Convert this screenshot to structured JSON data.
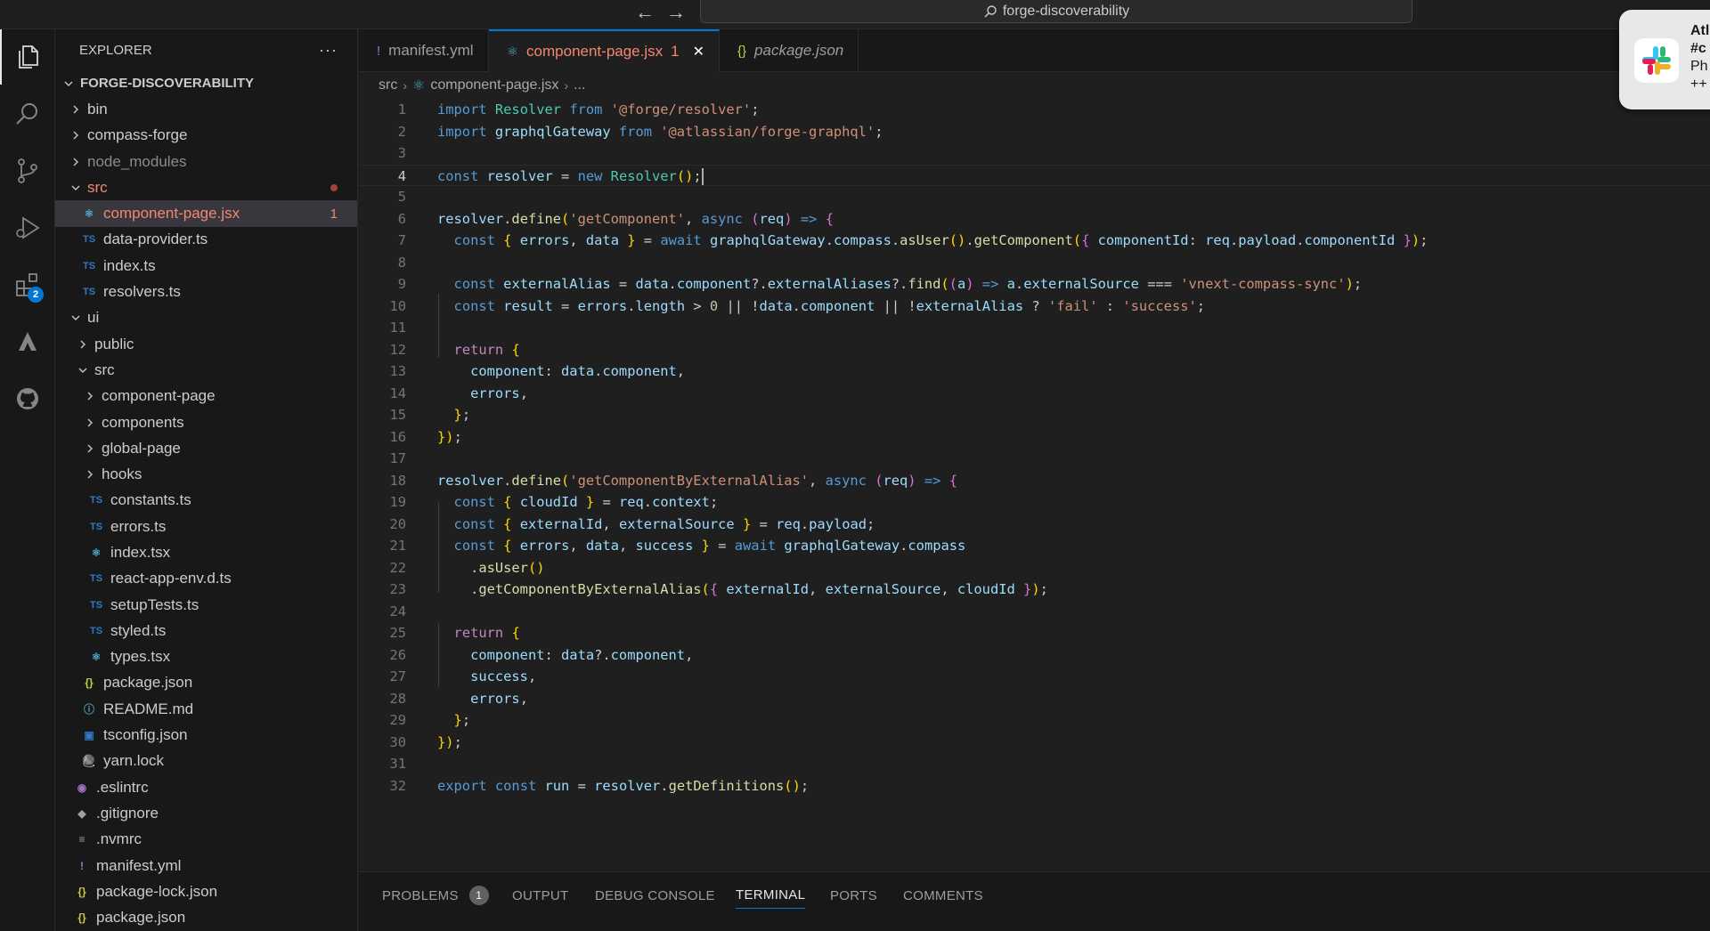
{
  "titlebar": {
    "back": "←",
    "forward": "→",
    "search_text": "forge-discoverability"
  },
  "activity": {
    "extensions_badge": "2"
  },
  "explorer": {
    "title": "EXPLORER",
    "more": "···",
    "root": "FORGE-DISCOVERABILITY",
    "items": [
      {
        "label": "bin",
        "kind": "folder",
        "depth": 1,
        "open": false
      },
      {
        "label": "compass-forge",
        "kind": "folder",
        "depth": 1,
        "open": false
      },
      {
        "label": "node_modules",
        "kind": "folder",
        "depth": 1,
        "open": false,
        "dim": true
      },
      {
        "label": "src",
        "kind": "folder",
        "depth": 1,
        "open": true,
        "error": true,
        "dot": true
      },
      {
        "label": "component-page.jsx",
        "kind": "react",
        "depth": 2,
        "error": true,
        "selected": true,
        "count": "1"
      },
      {
        "label": "data-provider.ts",
        "kind": "ts",
        "depth": 2
      },
      {
        "label": "index.ts",
        "kind": "ts",
        "depth": 2
      },
      {
        "label": "resolvers.ts",
        "kind": "ts",
        "depth": 2
      },
      {
        "label": "ui",
        "kind": "folder",
        "depth": 1,
        "open": true
      },
      {
        "label": "public",
        "kind": "folder",
        "depth": 2,
        "open": false
      },
      {
        "label": "src",
        "kind": "folder",
        "depth": 2,
        "open": true
      },
      {
        "label": "component-page",
        "kind": "folder",
        "depth": 3,
        "open": false
      },
      {
        "label": "components",
        "kind": "folder",
        "depth": 3,
        "open": false
      },
      {
        "label": "global-page",
        "kind": "folder",
        "depth": 3,
        "open": false
      },
      {
        "label": "hooks",
        "kind": "folder",
        "depth": 3,
        "open": false
      },
      {
        "label": "constants.ts",
        "kind": "ts",
        "depth": 3
      },
      {
        "label": "errors.ts",
        "kind": "ts",
        "depth": 3
      },
      {
        "label": "index.tsx",
        "kind": "react",
        "depth": 3
      },
      {
        "label": "react-app-env.d.ts",
        "kind": "ts",
        "depth": 3
      },
      {
        "label": "setupTests.ts",
        "kind": "ts",
        "depth": 3
      },
      {
        "label": "styled.ts",
        "kind": "ts",
        "depth": 3
      },
      {
        "label": "types.tsx",
        "kind": "react",
        "depth": 3
      },
      {
        "label": "package.json",
        "kind": "json",
        "depth": 2
      },
      {
        "label": "README.md",
        "kind": "info",
        "depth": 2
      },
      {
        "label": "tsconfig.json",
        "kind": "tsconfig",
        "depth": 2
      },
      {
        "label": "yarn.lock",
        "kind": "yarn",
        "depth": 2
      },
      {
        "label": ".eslintrc",
        "kind": "eslint",
        "depth": 1
      },
      {
        "label": ".gitignore",
        "kind": "git",
        "depth": 1
      },
      {
        "label": ".nvmrc",
        "kind": "text",
        "depth": 1
      },
      {
        "label": "manifest.yml",
        "kind": "yml",
        "depth": 1
      },
      {
        "label": "package-lock.json",
        "kind": "json",
        "depth": 1
      },
      {
        "label": "package.json",
        "kind": "json",
        "depth": 1
      }
    ]
  },
  "tabs": [
    {
      "label": "manifest.yml",
      "icon": "!",
      "active": false,
      "italic": false
    },
    {
      "label": "component-page.jsx",
      "icon": "⚛",
      "active": true,
      "italic": false,
      "problems": "1",
      "close": "✕"
    },
    {
      "label": "package.json",
      "icon": "{}",
      "active": false,
      "italic": true
    }
  ],
  "breadcrumb": {
    "folder": "src",
    "file": "component-page.jsx",
    "more": "..."
  },
  "code": {
    "current_line": 4,
    "lines": [
      "import Resolver from '@forge/resolver';",
      "import graphqlGateway from '@atlassian/forge-graphql';",
      "",
      "const resolver = new Resolver();",
      "",
      "resolver.define('getComponent', async (req) => {",
      "  const { errors, data } = await graphqlGateway.compass.asUser().getComponent({ componentId: req.payload.componentId });",
      "",
      "  const externalAlias = data.component?.externalAliases?.find((a) => a.externalSource === 'vnext-compass-sync');",
      "  const result = errors.length > 0 || !data.component || !externalAlias ? 'fail' : 'success';",
      "",
      "  return {",
      "    component: data.component,",
      "    errors,",
      "  };",
      "});",
      "",
      "resolver.define('getComponentByExternalAlias', async (req) => {",
      "  const { cloudId } = req.context;",
      "  const { externalId, externalSource } = req.payload;",
      "  const { errors, data, success } = await graphqlGateway.compass",
      "    .asUser()",
      "    .getComponentByExternalAlias({ externalId, externalSource, cloudId });",
      "",
      "  return {",
      "    component: data?.component,",
      "    success,",
      "    errors,",
      "  };",
      "});",
      "",
      "export const run = resolver.getDefinitions();"
    ]
  },
  "panel": {
    "tabs": [
      {
        "label": "PROBLEMS",
        "badge": "1"
      },
      {
        "label": "OUTPUT"
      },
      {
        "label": "DEBUG CONSOLE"
      },
      {
        "label": "TERMINAL",
        "active": true
      },
      {
        "label": "PORTS"
      },
      {
        "label": "COMMENTS"
      }
    ]
  },
  "notification": {
    "app": "slack-icon",
    "lines": [
      "Atl",
      "#c",
      "Ph",
      "++"
    ]
  },
  "colors": {
    "accent": "#0078d4",
    "error": "#f48771",
    "editor_bg": "#1f1f1f",
    "sidebar_bg": "#181818"
  }
}
